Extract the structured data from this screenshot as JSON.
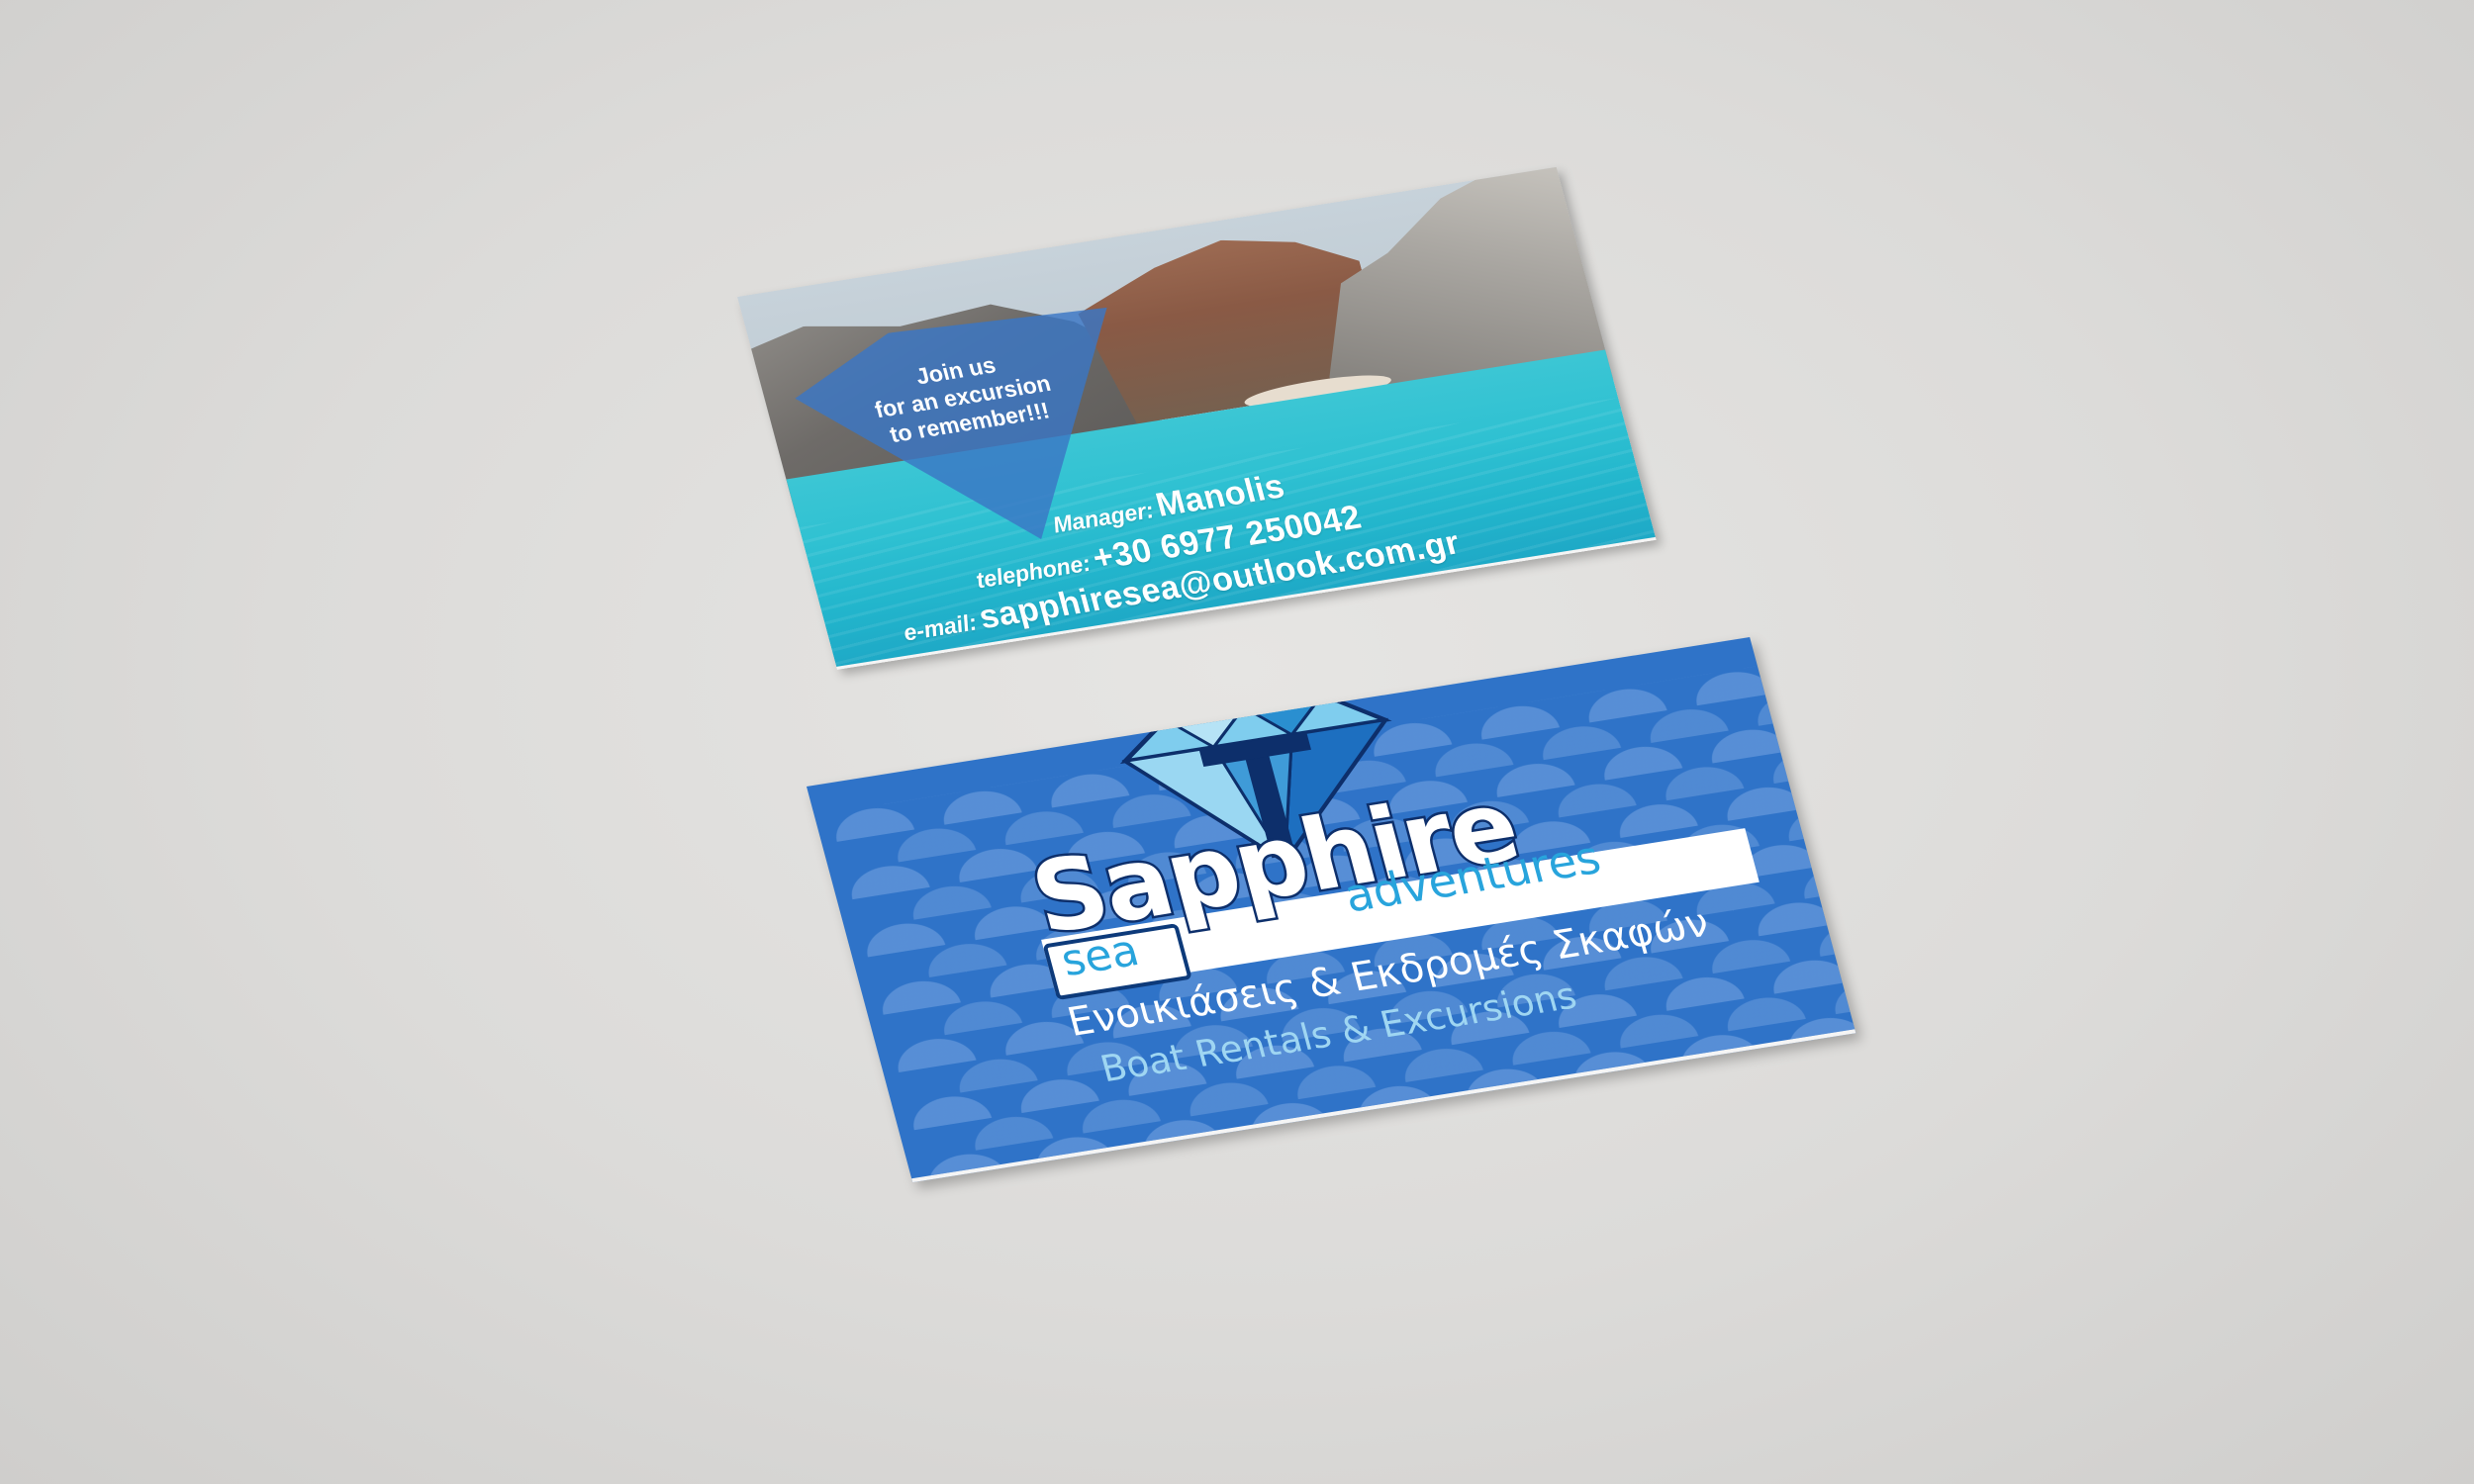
{
  "back_card": {
    "badge_line1": "Join us",
    "badge_line2": "for an excursion",
    "badge_line3": "to remember!!!",
    "manager_label": "Manager:",
    "manager_name": "Manolis",
    "phone_label": "telephone:",
    "phone_value": "+30 6977 250042",
    "email_label": "e-mail:",
    "email_value": "sapphiresea@outlook.com.gr"
  },
  "front_card": {
    "logo_word": "Sapphire",
    "logo_sea": "sea",
    "logo_adventures": "adventures",
    "tagline_greek": "Ενοικιάσεις & Εκδρομές Σκαφών",
    "tagline_english": "Boat Rentals & Excursions"
  },
  "colors": {
    "background": "#dcdbd9",
    "card_blue": "#2f73c8",
    "logo_navy": "#0d2f6b",
    "logo_cyan": "#28a4dc",
    "sea_turquoise": "#2fc1d2"
  },
  "icons": [
    "diamond-gem-icon"
  ]
}
